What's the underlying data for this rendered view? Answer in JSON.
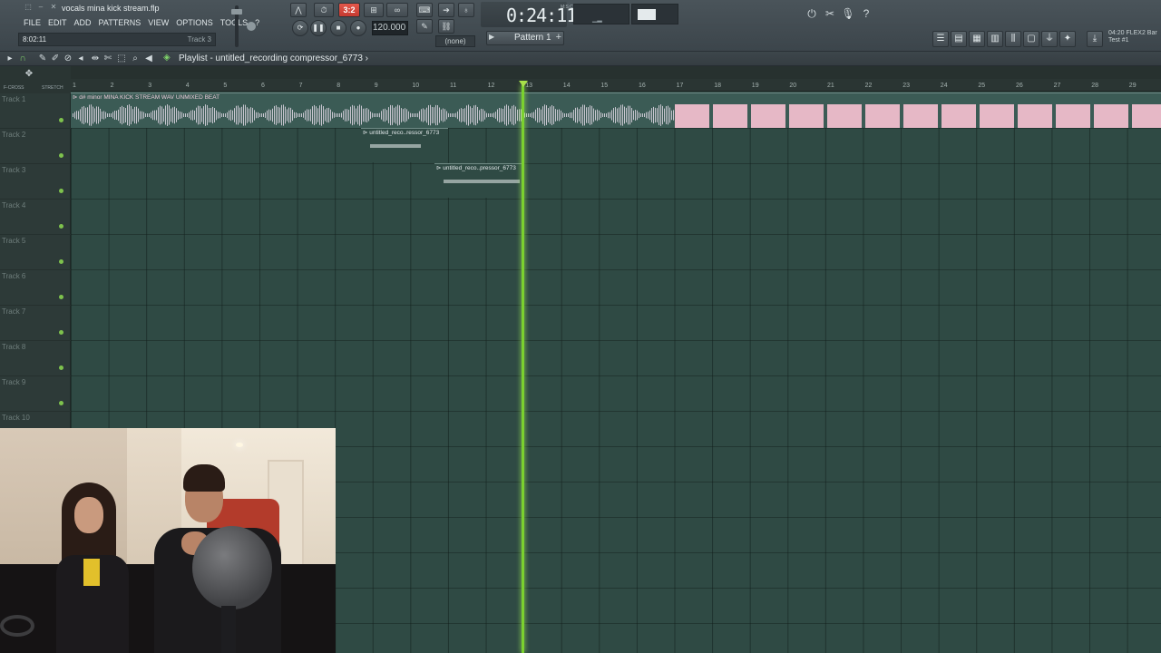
{
  "window": {
    "title": "vocals mina kick stream.flp",
    "controls": [
      "⬚",
      "–",
      "✕"
    ]
  },
  "menu": [
    "FILE",
    "EDIT",
    "ADD",
    "PATTERNS",
    "VIEW",
    "OPTIONS",
    "TOOLS",
    "?"
  ],
  "hint": {
    "time": "8:02:11",
    "track": "Track 3"
  },
  "transport": {
    "mode_icons": [
      "metronome-icon",
      "wait-icon"
    ],
    "beat_indicator": "3:2",
    "tempo": "120.000",
    "snap": "(none)",
    "time": "0:24:11",
    "time_unit": "M:S:CS"
  },
  "pattern": {
    "label": "Pattern 1",
    "plus": "+"
  },
  "news": {
    "line1": "04:20  FLEX2 Bar",
    "line2": "Test #1"
  },
  "playlist": {
    "title": "Playlist - untitled_recording compressor_6773",
    "title_arrow": "›"
  },
  "track_tools": {
    "left_label": "F-CROSS",
    "right_label": "STRETCH"
  },
  "tracks": [
    "Track 1",
    "Track 2",
    "Track 3",
    "Track 4",
    "Track 5",
    "Track 6",
    "Track 7",
    "Track 8",
    "Track 9",
    "Track 10"
  ],
  "ruler": [
    "1",
    "2",
    "3",
    "4",
    "5",
    "6",
    "7",
    "8",
    "9",
    "10",
    "11",
    "12",
    "13",
    "14",
    "15",
    "16",
    "17",
    "18",
    "19",
    "20",
    "21",
    "22",
    "23",
    "24",
    "25",
    "26",
    "27",
    "28",
    "29"
  ],
  "clips": {
    "main": "d# minor MINA KICK STREAM WAV UNMIXED BEAT",
    "rec1": "untitled_reco..ressor_6773",
    "rec2": "untitled_reco..pressor_6773"
  },
  "playhead": {
    "bar": 13
  },
  "colors": {
    "playhead": "#7bd12f",
    "grid_bg": "#2f4a44",
    "clip_wave": "#e6b8c6",
    "red_button": "#e4574b"
  }
}
